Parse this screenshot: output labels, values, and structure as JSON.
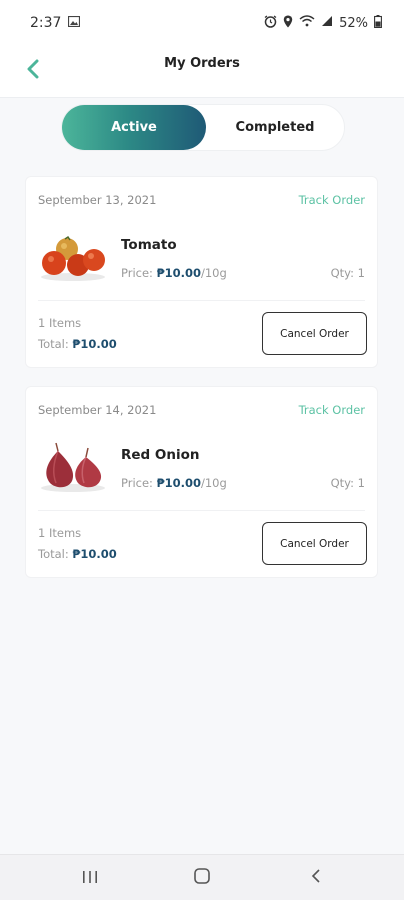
{
  "status_bar": {
    "time": "2:37",
    "battery": "52%"
  },
  "header": {
    "title": "My Orders",
    "back_icon": "chevron-left-icon"
  },
  "tabs": [
    {
      "label": "Active",
      "active": true
    },
    {
      "label": "Completed",
      "active": false
    }
  ],
  "orders": [
    {
      "date": "September 13, 2021",
      "track_label": "Track Order",
      "product": "Tomato",
      "price_label": "Price:",
      "price": "₱10.00",
      "unit": "/10g",
      "qty": "Qty: 1",
      "items": "1 Items",
      "total_label": "Total:",
      "total": "₱10.00",
      "cancel_label": "Cancel Order"
    },
    {
      "date": "September 14, 2021",
      "track_label": "Track Order",
      "product": "Red Onion",
      "price_label": "Price:",
      "price": "₱10.00",
      "unit": "/10g",
      "qty": "Qty: 1",
      "items": "1 Items",
      "total_label": "Total:",
      "total": "₱10.00",
      "cancel_label": "Cancel Order"
    }
  ],
  "colors": {
    "accent": "#5cc2a4",
    "price": "#1e4e6e",
    "gradient_start": "#4cb59a",
    "gradient_end": "#1f5a76"
  }
}
